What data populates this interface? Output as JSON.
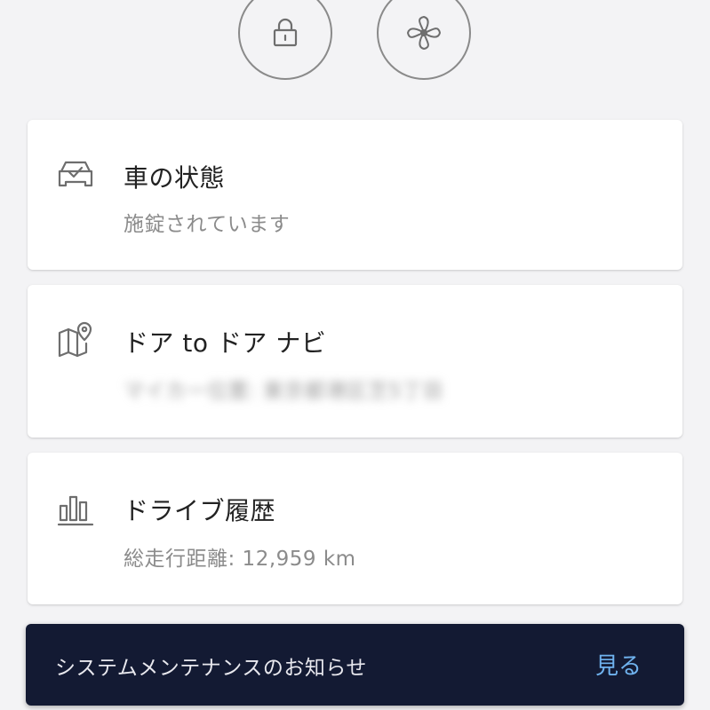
{
  "top_buttons": {
    "lock_icon": "lock-icon",
    "fan_icon": "fan-icon"
  },
  "cards": {
    "status": {
      "icon": "car-check-icon",
      "title": "車の状態",
      "subtitle": "施錠されています"
    },
    "navi": {
      "icon": "map-pin-icon",
      "title": "ドア to ドア ナビ",
      "subtitle": "マイカー位置: 東京都港区芝5丁目"
    },
    "drive": {
      "icon": "bar-chart-icon",
      "title": "ドライブ履歴",
      "subtitle": "総走行距離: 12,959 km"
    }
  },
  "snackbar": {
    "message": "システムメンテナンスのお知らせ",
    "action": "見る"
  },
  "colors": {
    "background": "#f3f3f5",
    "snackbar_bg": "#131a33",
    "action_blue": "#6fb2ee",
    "icon_gray": "#6e6e6e"
  }
}
